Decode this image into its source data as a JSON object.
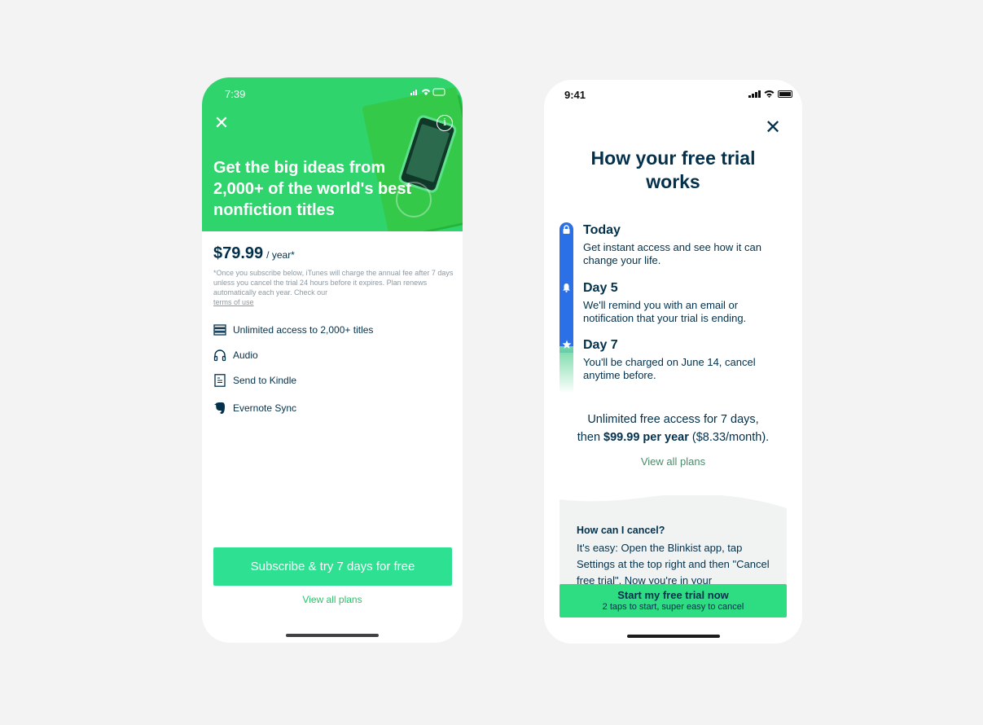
{
  "phone1": {
    "status_time": "7:39",
    "headline": "Get the big ideas from 2,000+ of the world's best nonfiction titles",
    "price": "$79.99",
    "price_period": "/ year*",
    "fine_print": "*Once you subscribe below, iTunes will charge the annual fee after 7 days unless you cancel the trial 24 hours before it expires. Plan renews automatically each year. Check our",
    "terms_link": "terms of use",
    "features": [
      {
        "label": "Unlimited access to 2,000+ titles",
        "icon": "books-icon"
      },
      {
        "label": "Audio",
        "icon": "headphones-icon"
      },
      {
        "label": "Send to Kindle",
        "icon": "kindle-icon"
      },
      {
        "label": "Evernote Sync",
        "icon": "evernote-icon"
      }
    ],
    "cta": "Subscribe & try 7 days for free",
    "view_all": "View all plans",
    "colors": {
      "hero": "#2fd46d",
      "cta": "#2ee091",
      "link": "#2ac26b"
    }
  },
  "phone2": {
    "status_time": "9:41",
    "title": "How your free trial works",
    "steps": [
      {
        "heading": "Today",
        "desc": "Get instant access and see how it can change your life.",
        "icon": "lock-icon"
      },
      {
        "heading": "Day 5",
        "desc": "We'll remind you with an email or notification that your trial is ending.",
        "icon": "bell-icon"
      },
      {
        "heading": "Day 7",
        "desc": "You'll be charged on June 14, cancel anytime before.",
        "icon": "star-icon"
      }
    ],
    "summary_line1": "Unlimited free access for 7 days,",
    "summary_then": "then",
    "summary_price": "$99.99 per year",
    "summary_month": "($8.33/month).",
    "view_all": "View all plans",
    "faq_question": "How can I cancel?",
    "faq_answer": "It's easy: Open the Blinkist app, tap Settings at the top right and then \"Cancel free trial\". Now you're in your",
    "cta_title": "Start my free trial now",
    "cta_subtitle": "2 taps to start, super easy to cancel",
    "colors": {
      "timeline": "#2c70e8",
      "cta": "#2edc82",
      "text": "#03314b"
    }
  }
}
